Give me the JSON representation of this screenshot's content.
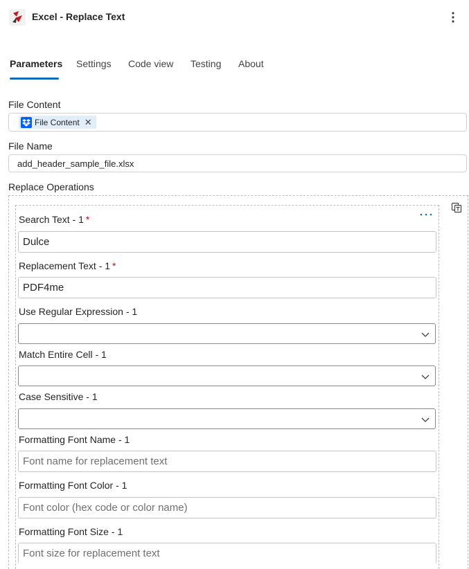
{
  "header": {
    "title": "Excel - Replace Text",
    "app_icon": "pdf4me-logo-icon",
    "more_icon": "more-vertical-icon"
  },
  "tabs": [
    {
      "label": "Parameters",
      "active": true
    },
    {
      "label": "Settings",
      "active": false
    },
    {
      "label": "Code view",
      "active": false
    },
    {
      "label": "Testing",
      "active": false
    },
    {
      "label": "About",
      "active": false
    }
  ],
  "fields": {
    "file_content": {
      "label": "File Content",
      "token": {
        "label": "File Content",
        "icon": "dropbox-icon",
        "color": "#0061fe"
      }
    },
    "file_name": {
      "label": "File Name",
      "value": "add_header_sample_file.xlsx"
    }
  },
  "replace_operations": {
    "label": "Replace Operations",
    "copy_icon": "copy-paste-icon",
    "item_more_icon": "more-horizontal-icon",
    "item": {
      "search_text": {
        "label": "Search Text - 1",
        "required_mark": "*",
        "value": "Dulce"
      },
      "replacement_text": {
        "label": "Replacement Text - 1",
        "required_mark": "*",
        "value": "PDF4me"
      },
      "use_regex": {
        "label": "Use Regular Expression - 1",
        "value": ""
      },
      "match_entire_cell": {
        "label": "Match Entire Cell - 1",
        "value": ""
      },
      "case_sensitive": {
        "label": "Case Sensitive - 1",
        "value": ""
      },
      "font_name": {
        "label": "Formatting Font Name - 1",
        "placeholder": "Font name for replacement text"
      },
      "font_color": {
        "label": "Formatting Font Color - 1",
        "placeholder": "Font color (hex code or color name)"
      },
      "font_size": {
        "label": "Formatting Font Size - 1",
        "placeholder": "Font size for replacement text"
      }
    }
  },
  "colors": {
    "accent": "#0f6cbd",
    "required": "#c50f1f",
    "token_bg": "#e1eefa"
  }
}
